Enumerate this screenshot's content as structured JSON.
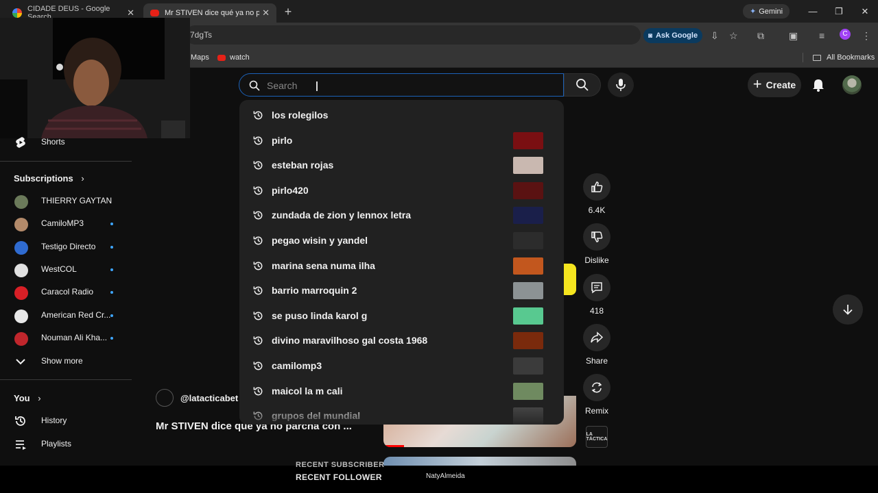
{
  "browser": {
    "tabs": [
      {
        "title": "CIDADE DEUS - Google Search",
        "favicon": "google-icon",
        "active": false
      },
      {
        "title": "Mr STIVEN dice qué ya no parc",
        "favicon": "youtube-icon",
        "active": true
      }
    ],
    "gemini_label": "Gemini",
    "url_fragment": "7dgTs",
    "ask_google_label": "Ask Google",
    "profile_initial": "C",
    "bookmarks": [
      {
        "label": "Maps",
        "icon": "maps-icon"
      },
      {
        "label": "watch",
        "icon": "youtube-icon"
      }
    ],
    "all_bookmarks_label": "All Bookmarks"
  },
  "youtube": {
    "search": {
      "placeholder": "Search"
    },
    "create_label": "Create",
    "suggestions": [
      {
        "text": "los rolegilos",
        "thumb": null
      },
      {
        "text": "pirlo",
        "thumb": "#7a0f12"
      },
      {
        "text": "esteban rojas",
        "thumb": "#c9b8b0"
      },
      {
        "text": "pirlo420",
        "thumb": "#5a1212"
      },
      {
        "text": "zundada de zion y lennox letra",
        "thumb": "#1a1f4a"
      },
      {
        "text": "pegao wisin y yandel",
        "thumb": "#2c2c2c"
      },
      {
        "text": "marina sena numa ilha",
        "thumb": "#c2571e"
      },
      {
        "text": "barrio marroquin 2",
        "thumb": "#8c9294"
      },
      {
        "text": "se puso linda karol g",
        "thumb": "#58c990"
      },
      {
        "text": "divino maravilhoso gal costa 1968",
        "thumb": "#7a2a0c"
      },
      {
        "text": "camilomp3",
        "thumb": "#3b3b3b"
      },
      {
        "text": "maicol la m cali",
        "thumb": "#6f8a60"
      },
      {
        "text": "grupos del mundial",
        "thumb": "#4a4a4a"
      }
    ],
    "sidebar": {
      "shorts_label": "Shorts",
      "subscriptions_title": "Subscriptions",
      "subscriptions": [
        {
          "name": "THIERRY GAYTAN",
          "color": "#6b7a5a",
          "new": false
        },
        {
          "name": "CamiloMP3",
          "color": "#b38a6a",
          "new": true
        },
        {
          "name": "Testigo Directo",
          "color": "#2f6bd0",
          "new": true
        },
        {
          "name": "WestCOL",
          "color": "#e0e0e0",
          "new": true
        },
        {
          "name": "Caracol Radio",
          "color": "#d81f26",
          "new": true
        },
        {
          "name": "American Red Cr...",
          "color": "#e8e8e8",
          "new": true
        },
        {
          "name": "Nouman Ali Kha...",
          "color": "#c0262c",
          "new": true
        }
      ],
      "show_more_label": "Show more",
      "you_title": "You",
      "you_items": [
        {
          "label": "History"
        },
        {
          "label": "Playlists"
        }
      ]
    },
    "short": {
      "channel_handle": "@latacticabet",
      "title": "Mr STIVEN dice qué ya no parcha con ...",
      "actions": {
        "likes": "6.4K",
        "dislike_label": "Dislike",
        "comments": "418",
        "share_label": "Share",
        "remix_label": "Remix"
      },
      "channel_thumb_text": "LA TÁCTICA"
    }
  },
  "stream_overlay": {
    "recent_subscriber_label": "RECENT SUBSCRIBER",
    "recent_follower_label": "RECENT FOLLOWER",
    "follower_name": "NatyAlmeida"
  }
}
